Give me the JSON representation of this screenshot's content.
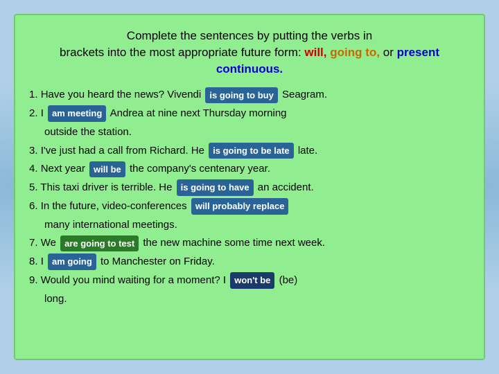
{
  "title": {
    "line1": "Complete the sentences by putting the verbs in",
    "line2_pre": "brackets into the most appropriate future form: ",
    "will": "will,",
    "line2_mid": "",
    "going_to": "going to,",
    "line2_connector": " or ",
    "present_continuous": "present continuous."
  },
  "sentences": [
    {
      "num": "1.",
      "pre": "Have you heard the news? Vivendi",
      "badge": "is going to buy",
      "post": "Seagram."
    },
    {
      "num": "2.",
      "pre": "I",
      "badge": "am meeting",
      "post": "Andrea at nine next Thursday morning"
    },
    {
      "num": "",
      "pre": "outside the station.",
      "badge": "",
      "post": "",
      "indent": true
    },
    {
      "num": "3.",
      "pre": "I've just had a call from Richard. He",
      "badge": "is going to be late",
      "post": "late."
    },
    {
      "num": "4.",
      "pre": "Next year",
      "badge": "will be",
      "post": "the company's centenary year."
    },
    {
      "num": "5.",
      "pre": "This taxi driver is terrible. He",
      "badge": "is going to have",
      "post": "an accident."
    },
    {
      "num": "6.",
      "pre": "In the future, video-conferences",
      "badge": "will probably replace",
      "post": ""
    },
    {
      "num": "",
      "pre": "many international meetings.",
      "badge": "",
      "post": "",
      "indent": true
    },
    {
      "num": "7.",
      "pre": "We",
      "badge": "are going to test",
      "post": "the new machine some time next week."
    },
    {
      "num": "8.",
      "pre": "I",
      "badge": "am going",
      "post": "to Manchester on Friday."
    },
    {
      "num": "9.",
      "pre": "Would you mind waiting for a moment? I",
      "badge": "won't be",
      "post": "(be)"
    },
    {
      "num": "",
      "pre": "long.",
      "badge": "",
      "post": "",
      "indent": true
    }
  ],
  "badge_labels": {
    "is_going_to_buy": "is going to buy",
    "am_meeting": "am meeting",
    "is_going_to_be_late": "is going to be late",
    "will_be": "will be",
    "is_going_to_have": "is going to have",
    "will_probably_replace": "will probably replace",
    "are_going_to_test": "are going to test",
    "am_going": "am going",
    "wont_be": "won't be"
  }
}
